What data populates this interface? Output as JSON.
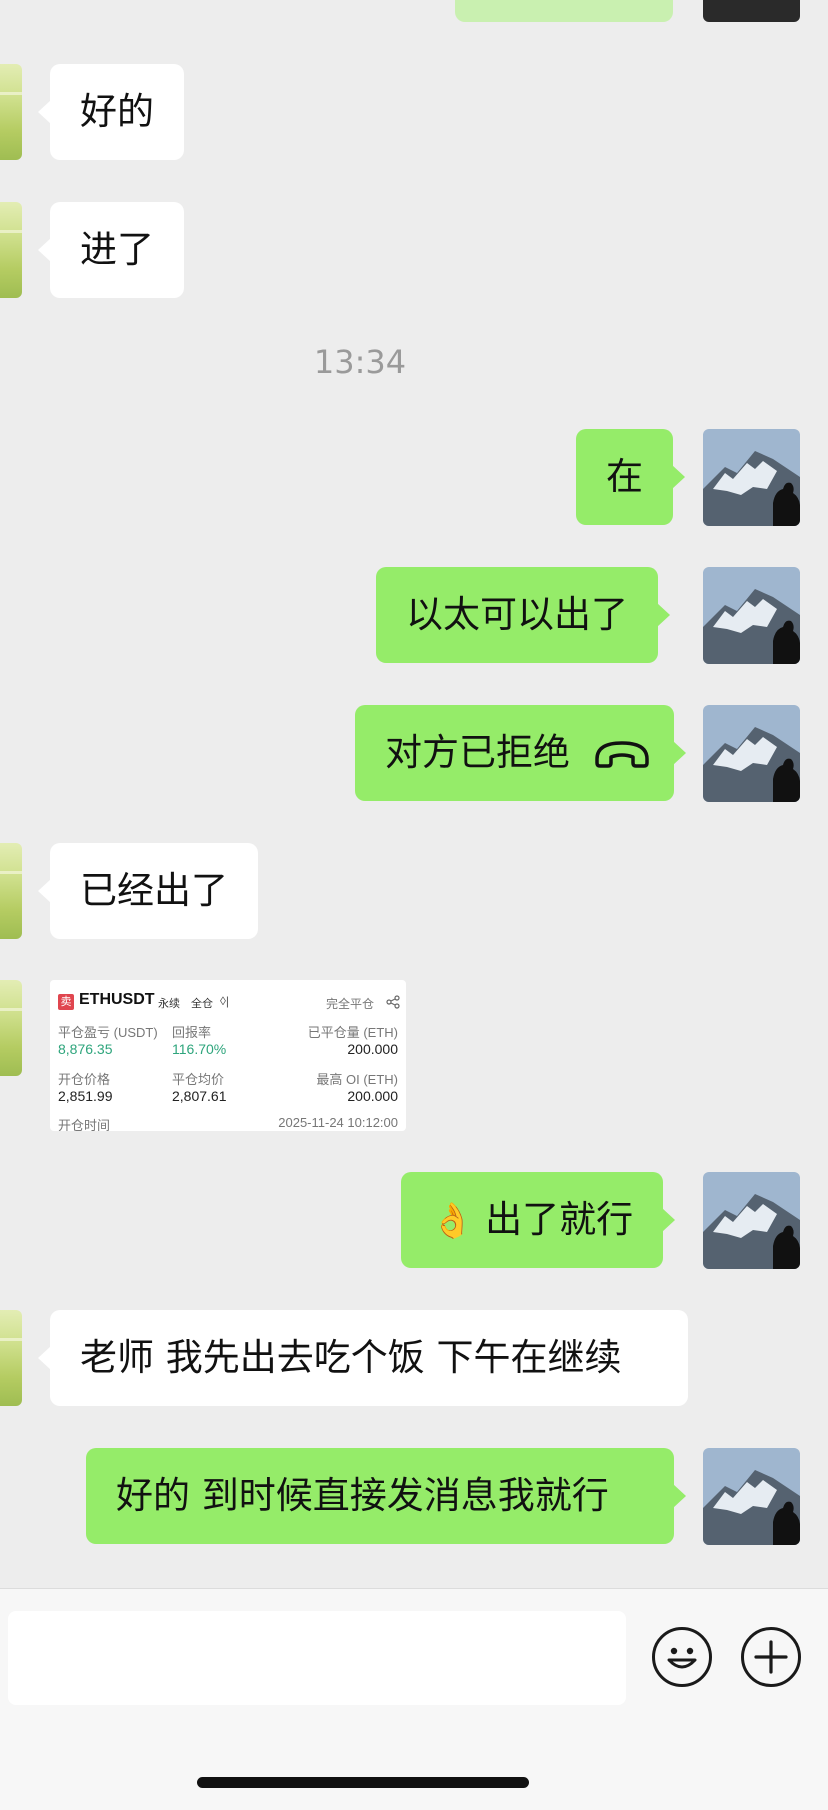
{
  "timestamp": "13:34",
  "messages": {
    "m1": "好的",
    "m2": "进了",
    "m3": "在",
    "m4": "以太可以出了",
    "m5": "对方已拒绝",
    "m6": "已经出了",
    "m8_emoji": "👌",
    "m8_text": "出了就行",
    "m9": "老师 我先出去吃个饭 下午在继续",
    "m10": "好的 到时候直接发消息我就行"
  },
  "trade_card": {
    "side_badge": "卖",
    "symbol": "ETHUSDT",
    "tag_perpetual": "永续",
    "tag_cross": "全仓",
    "status": "完全平仓",
    "close_pnl_label": "平仓盈亏 (USDT)",
    "close_pnl_value": "8,876.35",
    "roi_label": "回报率",
    "roi_value": "116.70%",
    "closed_qty_label": "已平仓量 (ETH)",
    "closed_qty_value": "200.000",
    "open_price_label": "开仓价格",
    "open_price_value": "2,851.99",
    "close_avg_label": "平仓均价",
    "close_avg_value": "2,807.61",
    "max_oi_label": "最高 OI (ETH)",
    "max_oi_value": "200.000",
    "close_time_label": "开仓时间",
    "close_time_value": "2025-11-24 10:12:00"
  },
  "colors": {
    "background": "#ededed",
    "bubble_self": "#95ec69",
    "bubble_other": "#ffffff",
    "profit_green": "#2ea57c",
    "sell_red": "#e0464f"
  }
}
